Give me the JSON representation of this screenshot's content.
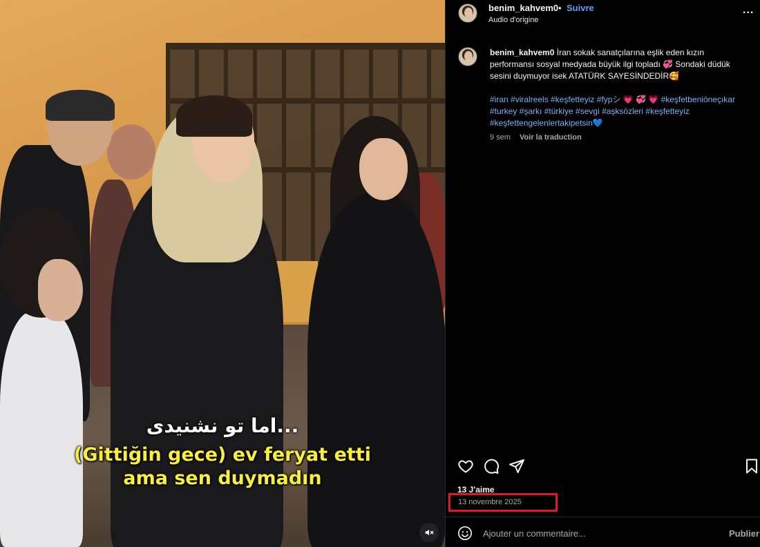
{
  "video": {
    "subtitle_fa": "...اما تو نشنیدی",
    "subtitle_tr_line1": "(Gittiğin gece) ev feryat etti",
    "subtitle_tr_line2": "ama sen duymadın",
    "mute_icon": "speaker-muted-icon"
  },
  "header": {
    "username": "benim_kahvem0",
    "separator": "•",
    "follow_label": "Suivre",
    "audio_label": "Audio d'origine",
    "more_label": "..."
  },
  "caption": {
    "username": "benim_kahvem0",
    "text": "İran sokak sanatçılarına eşlik eden kızın performansı sosyal medyada büyük ilgi topladı 💞 Sondaki düdük sesini duymuyor isek ATATÜRK SAYESİNDEDİR🥰",
    "hashtags": "#iran #viralreels #keşfetteyiz #fypシ 💗 💞 💗 #keşfetbeniöneçıkar #turkey #şarkı #türkiye #sevgi #aşksözleri #keşfetteyiz #keşfettengelenlertakipetsin💙",
    "age": "9 sem",
    "translate_label": "Voir la traduction"
  },
  "actions": {
    "like_icon": "heart-icon",
    "comment_icon": "comment-icon",
    "share_icon": "send-icon",
    "save_icon": "bookmark-icon"
  },
  "likes": "13 J'aime",
  "date": "13 novembre 2025",
  "comment": {
    "placeholder": "Ajouter un commentaire...",
    "publish_label": "Publier"
  },
  "colors": {
    "link": "#5da3f5",
    "hashtag": "#7fb0f5",
    "highlight_box": "#e01b1b",
    "subtitle": "#f7ef3c"
  }
}
